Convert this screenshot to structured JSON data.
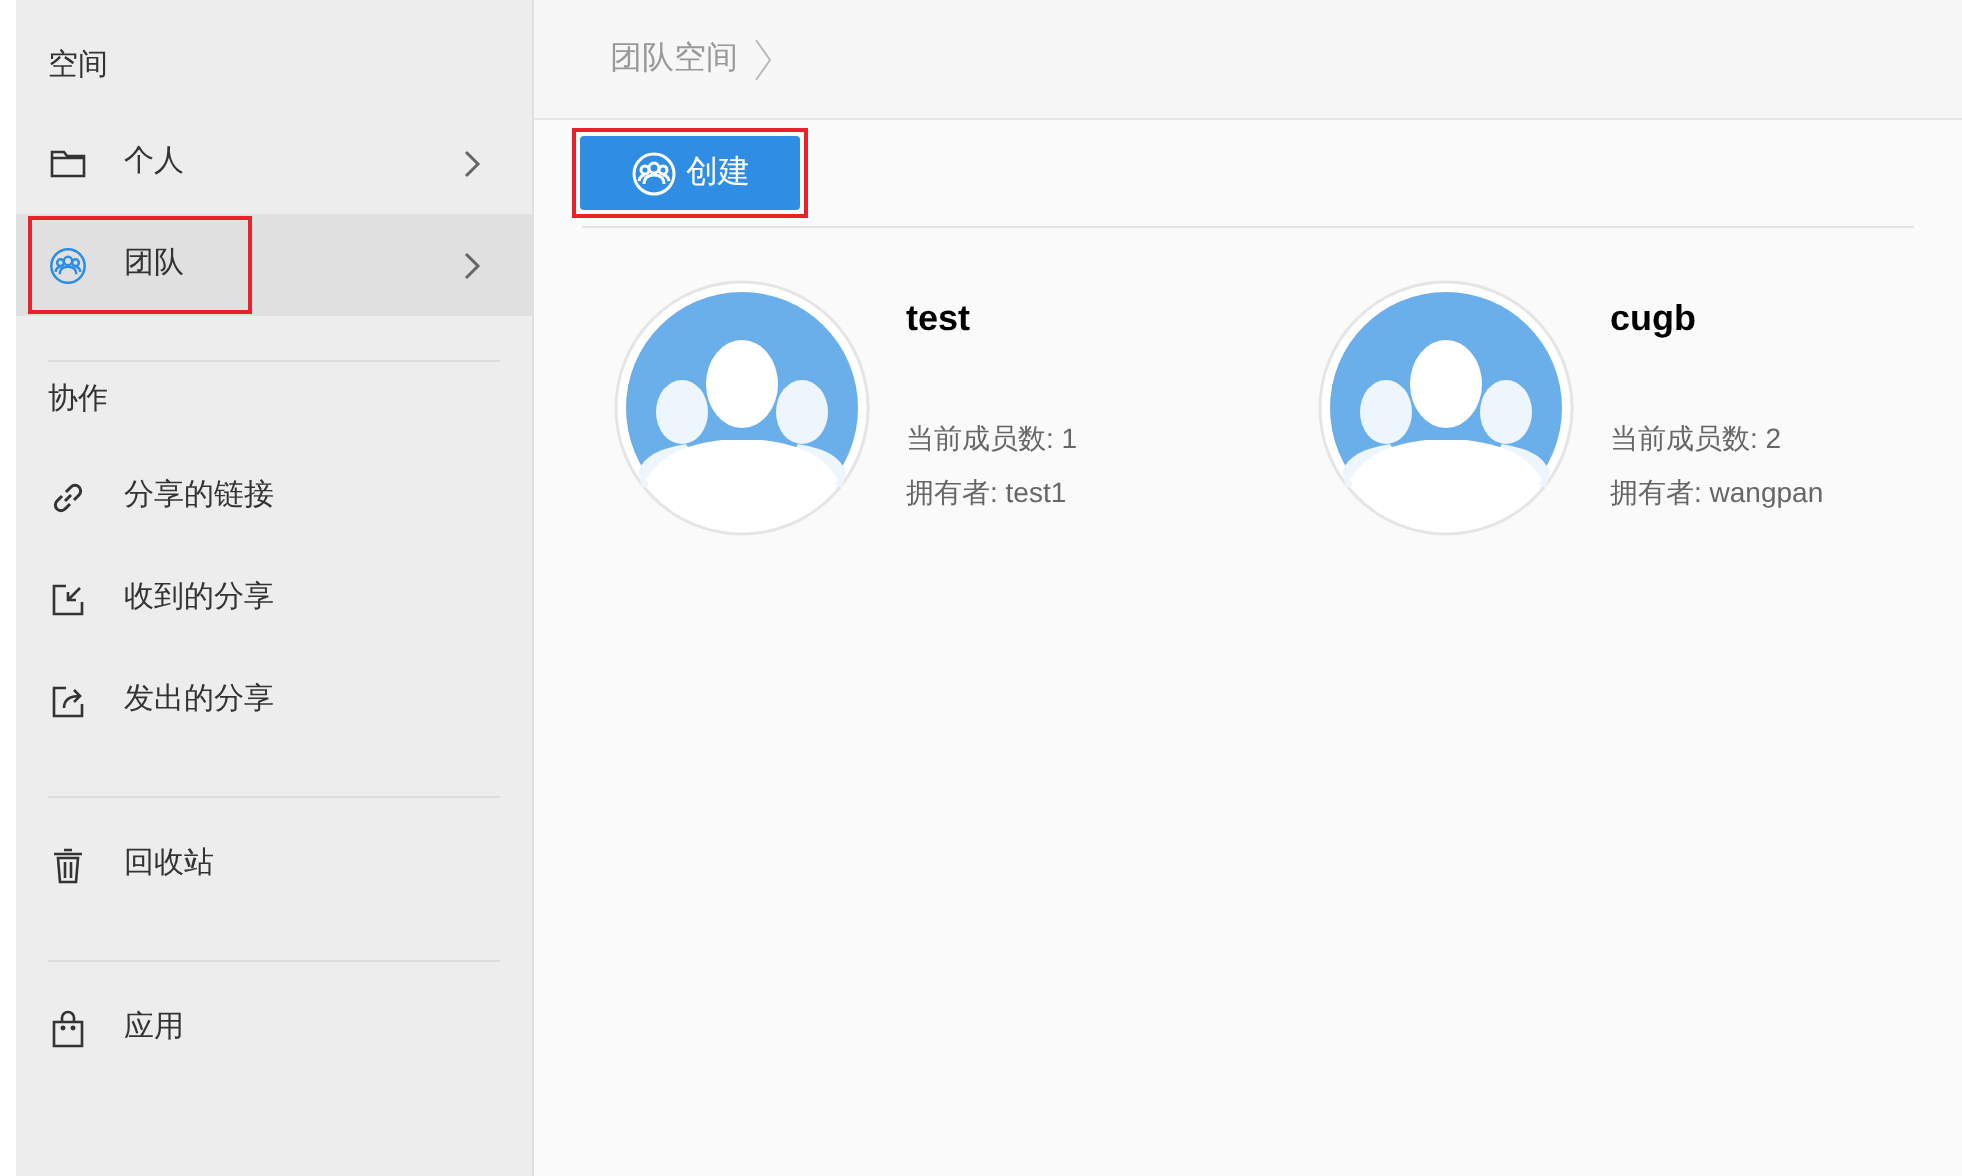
{
  "sidebar": {
    "sections": [
      {
        "title": "空间",
        "items": [
          {
            "label": "个人",
            "kind": "nav",
            "selected": false,
            "highlighted": false
          },
          {
            "label": "团队",
            "kind": "nav",
            "selected": true,
            "highlighted": true
          }
        ]
      },
      {
        "title": "协作",
        "items": [
          {
            "label": "分享的链接",
            "kind": "link",
            "selected": false,
            "highlighted": false
          },
          {
            "label": "收到的分享",
            "kind": "link",
            "selected": false,
            "highlighted": false
          },
          {
            "label": "发出的分享",
            "kind": "link",
            "selected": false,
            "highlighted": false
          }
        ]
      },
      {
        "items": [
          {
            "label": "回收站",
            "kind": "link",
            "selected": false,
            "highlighted": false
          }
        ]
      },
      {
        "items": [
          {
            "label": "应用",
            "kind": "link",
            "selected": false,
            "highlighted": false
          }
        ]
      }
    ]
  },
  "breadcrumb": [
    "团队空间"
  ],
  "toolbar": {
    "create_button": {
      "label": "创建",
      "highlighted": true
    }
  },
  "teams": [
    {
      "name": "test",
      "members": "当前成员数: 1",
      "owner": "拥有者: test1"
    },
    {
      "name": "cugb",
      "members": "当前成员数: 2",
      "owner": "拥有者: wangpan"
    }
  ]
}
